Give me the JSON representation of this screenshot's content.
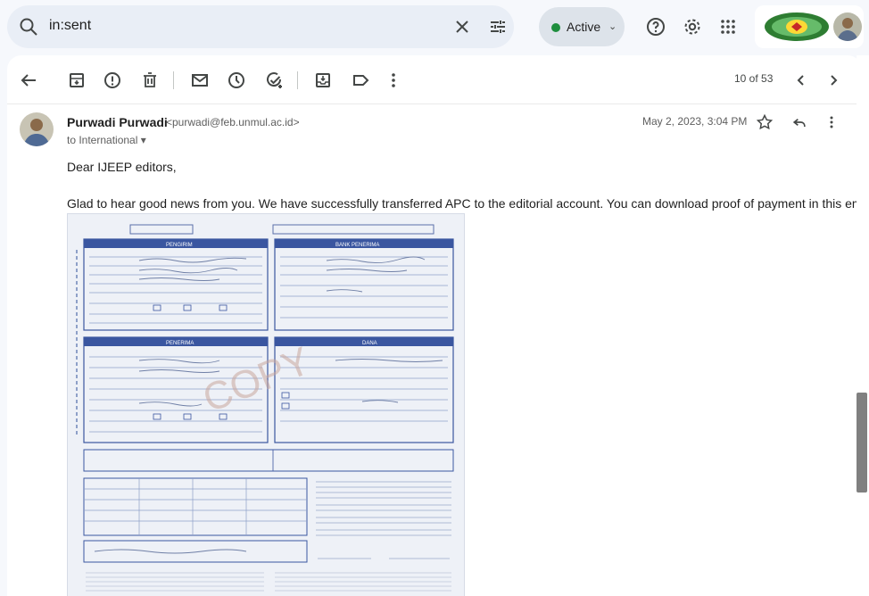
{
  "search": {
    "query": "in:sent"
  },
  "status": {
    "label": "Active",
    "color": "#1e8e3e"
  },
  "toolbar": {
    "pager": "10 of 53"
  },
  "message": {
    "sender_name": "Purwadi Purwadi",
    "sender_email": "<purwadi@feb.unmul.ac.id>",
    "to": "to International",
    "date": "May 2, 2023, 3:04 PM",
    "greeting": "Dear IJEEP editors,",
    "body": "Glad to hear good news from you. We have successfully transferred APC to the editorial account. You can download proof of payment in this email."
  },
  "attachment": {
    "section_a": "PENGIRIM",
    "section_b": "BANK PENERIMA",
    "section_c": "PENERIMA",
    "section_d": "DANA",
    "watermark": "COPY"
  },
  "icons": {
    "search": "search-icon",
    "clear": "close-icon",
    "tune": "tune-icon",
    "help": "help-icon",
    "settings": "gear-icon",
    "apps": "apps-icon",
    "back": "arrow-left-icon",
    "archive": "archive-icon",
    "report": "report-spam-icon",
    "delete": "trash-icon",
    "unread": "mail-icon",
    "snooze": "clock-icon",
    "task": "add-task-icon",
    "move": "move-to-icon",
    "label": "label-icon",
    "more": "more-vert-icon",
    "prev": "chevron-left-icon",
    "next": "chevron-right-icon",
    "star": "star-icon",
    "reply": "reply-icon"
  }
}
